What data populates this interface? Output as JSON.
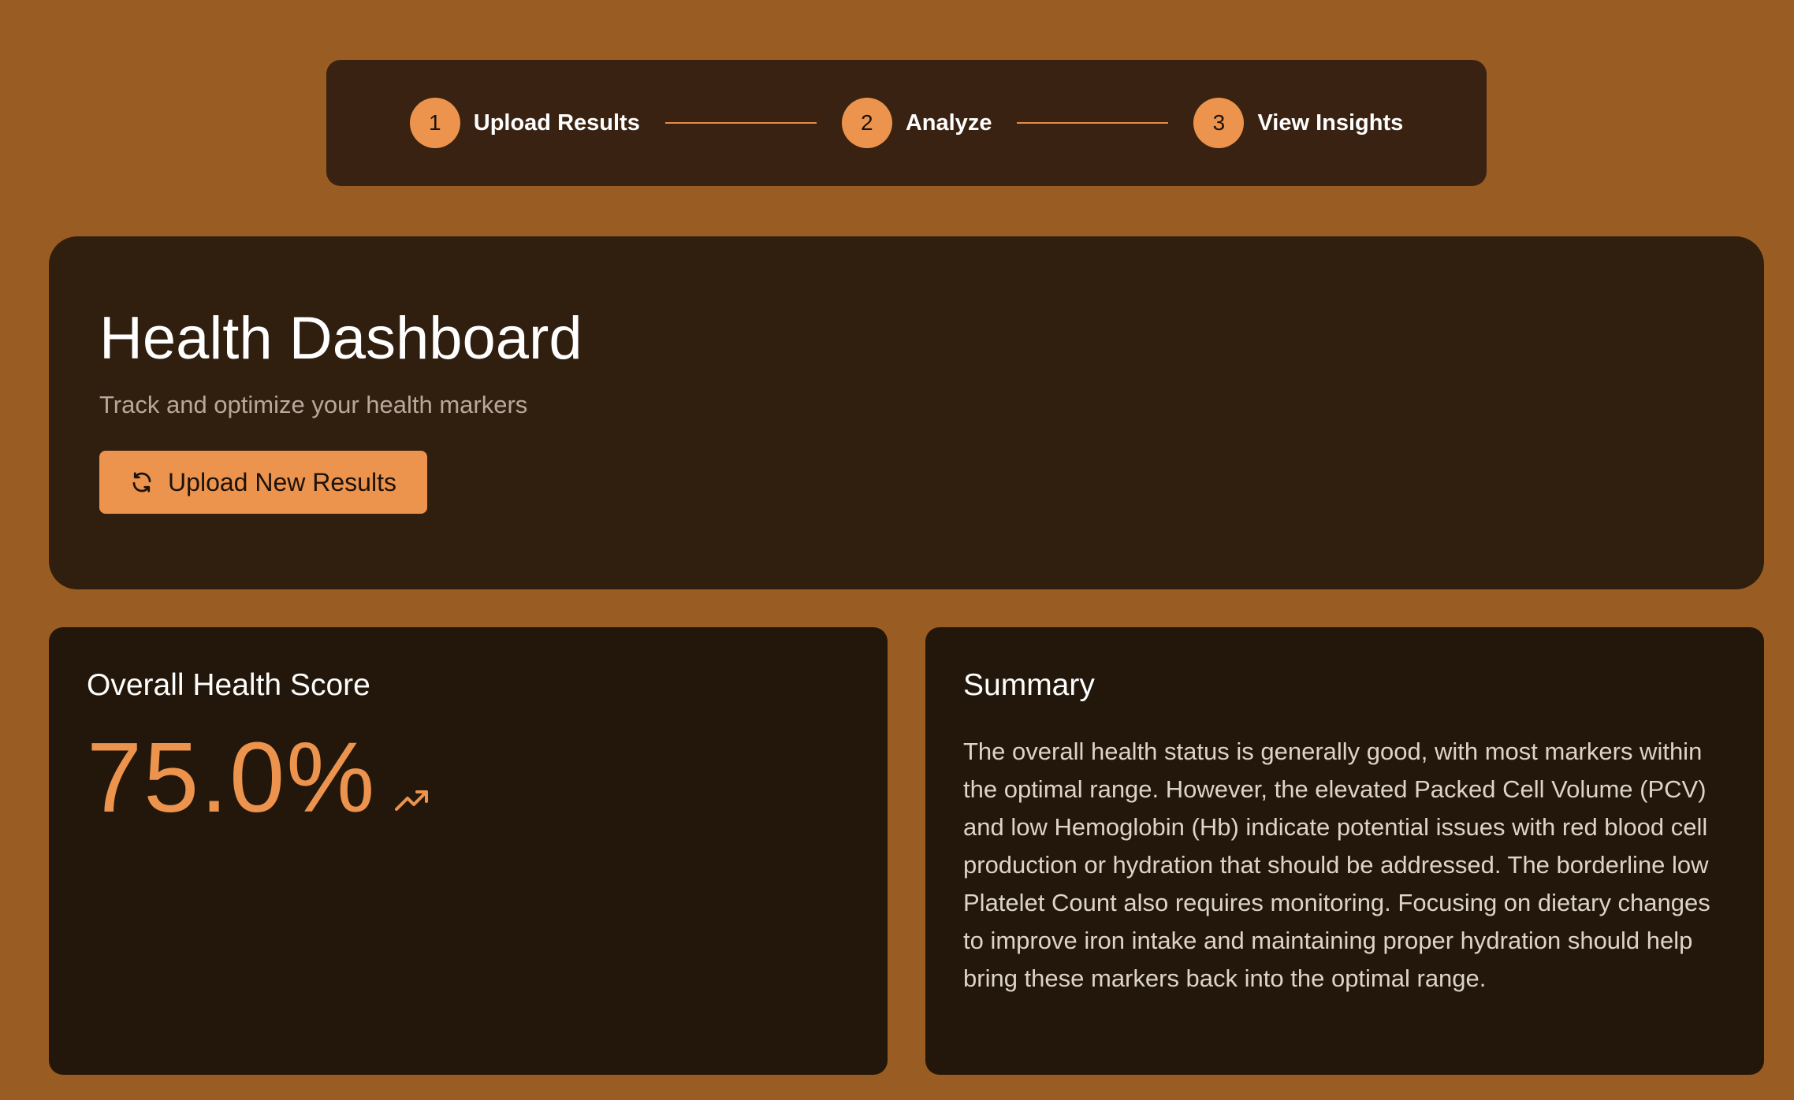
{
  "stepper": {
    "steps": [
      {
        "number": "1",
        "label": "Upload Results"
      },
      {
        "number": "2",
        "label": "Analyze"
      },
      {
        "number": "3",
        "label": "View Insights"
      }
    ]
  },
  "hero": {
    "title": "Health Dashboard",
    "subtitle": "Track and optimize your health markers",
    "upload_button_label": "Upload New Results",
    "upload_button_icon": "refresh-icon"
  },
  "score_card": {
    "title": "Overall Health Score",
    "value": "75.0%",
    "trend_icon": "trending-up-icon"
  },
  "summary_card": {
    "title": "Summary",
    "text": "The overall health status is generally good, with most markers within the optimal range. However, the elevated Packed Cell Volume (PCV) and low Hemoglobin (Hb) indicate potential issues with red blood cell production or hydration that should be addressed. The borderline low Platelet Count also requires monitoring. Focusing on dietary changes to improve iron intake and maintaining proper hydration should help bring these markers back into the optimal range."
  },
  "colors": {
    "background": "#995c22",
    "accent": "#ec934d",
    "card": "#23170b",
    "stepper": "#392211"
  }
}
